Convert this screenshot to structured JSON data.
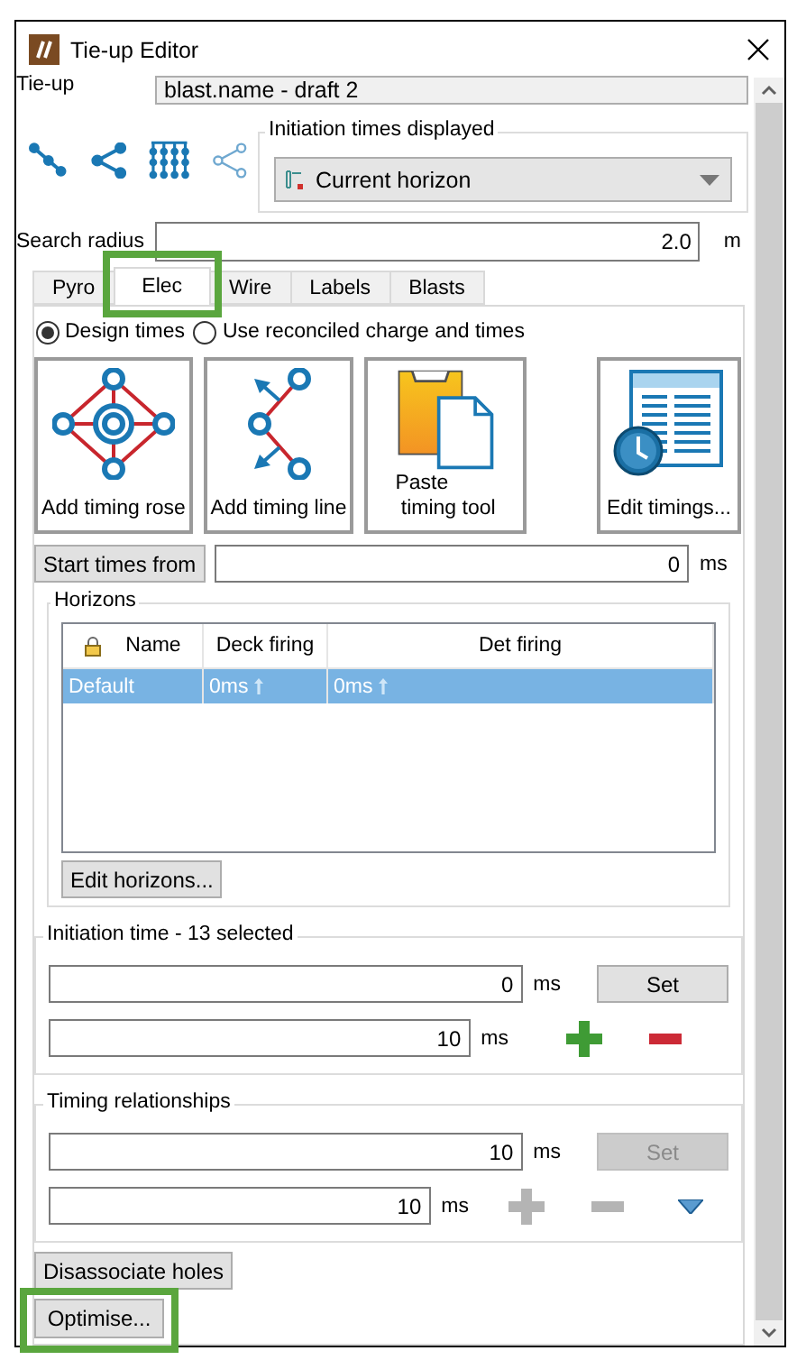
{
  "window": {
    "title": "Tie-up Editor"
  },
  "tie_up": {
    "label": "Tie-up",
    "value": "blast.name - draft 2"
  },
  "link_tools": [
    {
      "kind": "line",
      "disabled": false
    },
    {
      "kind": "fork",
      "disabled": false
    },
    {
      "kind": "grid",
      "disabled": false
    },
    {
      "kind": "fork",
      "disabled": true
    }
  ],
  "initiation_display": {
    "title": "Initiation times displayed",
    "value": "Current horizon"
  },
  "search_radius": {
    "label": "Search radius",
    "value": "2.0",
    "unit": "m"
  },
  "tabs": [
    {
      "label": "Pyro",
      "selected": false,
      "highlighted": false
    },
    {
      "label": "Elec",
      "selected": true,
      "highlighted": true
    },
    {
      "label": "Wire",
      "selected": false,
      "highlighted": false
    },
    {
      "label": "Labels",
      "selected": false,
      "highlighted": false
    },
    {
      "label": "Blasts",
      "selected": false,
      "highlighted": false
    }
  ],
  "time_source": [
    {
      "label": "Design times",
      "selected": true
    },
    {
      "label": "Use reconciled charge and times",
      "selected": false
    }
  ],
  "tools": [
    {
      "kind": "rose",
      "lines": [
        "Add timing rose"
      ]
    },
    {
      "kind": "line",
      "lines": [
        "Add timing line"
      ]
    },
    {
      "kind": "paste",
      "lines": [
        "Paste",
        "timing tool"
      ]
    },
    {
      "kind": "table",
      "lines": [
        "Edit timings..."
      ]
    }
  ],
  "start_times": {
    "button": "Start times from",
    "value": "0",
    "unit": "ms"
  },
  "horizons": {
    "title": "Horizons",
    "columns": [
      "Name",
      "Deck firing",
      "Det firing"
    ],
    "rows": [
      {
        "cells": [
          "Default",
          "0ms",
          "0ms"
        ],
        "selected": true
      }
    ],
    "edit_button": "Edit horizons..."
  },
  "initiation_time": {
    "title": "Initiation time - 13 selected",
    "value": "0",
    "unit": "ms",
    "set": {
      "label": "Set",
      "disabled": false
    },
    "step": "10",
    "step_unit": "ms",
    "steppers_disabled": false,
    "has_menu": false
  },
  "timing_relationships": {
    "title": "Timing relationships",
    "value": "10",
    "unit": "ms",
    "set": {
      "label": "Set",
      "disabled": true
    },
    "step": "10",
    "step_unit": "ms",
    "steppers_disabled": true,
    "has_menu": true
  },
  "buttons": [
    {
      "label": "Disassociate holes",
      "highlighted": false
    },
    {
      "label": "Optimise...",
      "highlighted": true
    }
  ]
}
